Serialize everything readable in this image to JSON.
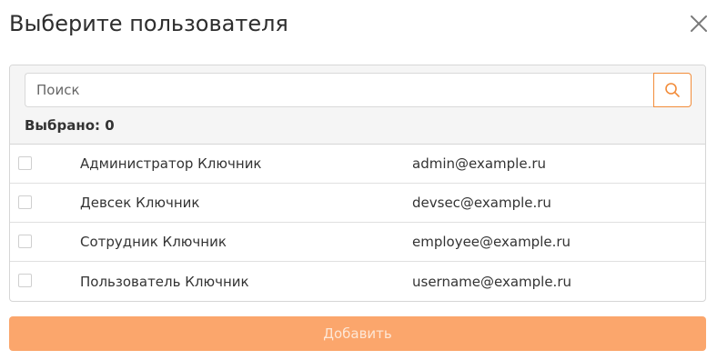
{
  "dialog": {
    "title": "Выберите пользователя",
    "close_icon": "close-icon"
  },
  "search": {
    "placeholder": "Поиск",
    "value": "",
    "button_icon": "search-icon"
  },
  "selection": {
    "label": "Выбрано: 0"
  },
  "users": [
    {
      "name": "Администратор Ключник",
      "email": "admin@example.ru",
      "checked": false
    },
    {
      "name": "Девсек Ключник",
      "email": "devsec@example.ru",
      "checked": false
    },
    {
      "name": "Сотрудник Ключник",
      "email": "employee@example.ru",
      "checked": false
    },
    {
      "name": "Пользователь Ключник",
      "email": "username@example.ru",
      "checked": false
    }
  ],
  "actions": {
    "add_label": "Добавить"
  },
  "colors": {
    "accent": "#f28c3a",
    "add_button_bg": "#fba66c",
    "add_button_text": "#fde7d6"
  }
}
